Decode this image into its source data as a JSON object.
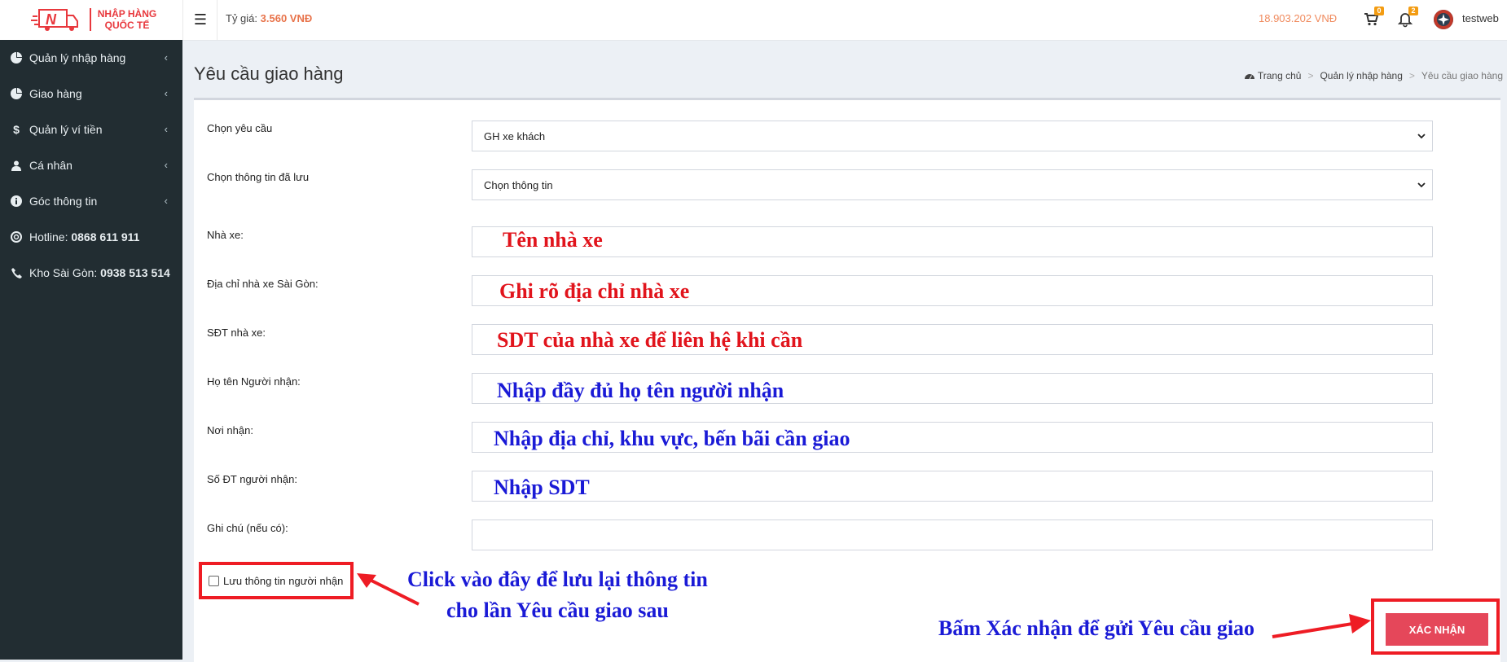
{
  "header": {
    "logo_text_line1": "NHẬP HÀNG",
    "logo_text_line2": "QUỐC TẾ",
    "logo_letter": "N",
    "rate_label": "Tỷ giá:",
    "rate_value": "3.560 VNĐ",
    "balance": "18.903.202 VNĐ",
    "cart_count": "0",
    "notification_count": "2",
    "username": "testweb"
  },
  "sidebar": {
    "items": [
      {
        "label": "Quản lý nhập hàng",
        "icon": "pie-chart-icon"
      },
      {
        "label": "Giao hàng",
        "icon": "pie-chart-icon"
      },
      {
        "label": "Quản lý ví tiền",
        "icon": "dollar-icon"
      },
      {
        "label": "Cá nhân",
        "icon": "user-icon"
      },
      {
        "label": "Góc thông tin",
        "icon": "info-icon"
      }
    ],
    "hotline_label": "Hotline:",
    "hotline_value": "0868 611 911",
    "warehouse_label": "Kho Sài Gòn:",
    "warehouse_value": "0938 513 514"
  },
  "page": {
    "title": "Yêu cầu giao hàng",
    "breadcrumb": [
      "Trang chủ",
      "Quản lý nhập hàng",
      "Yêu cầu giao hàng"
    ]
  },
  "form": {
    "request_label": "Chọn yêu cầu",
    "request_value": "GH xe khách",
    "saved_label": "Chọn thông tin đã lưu",
    "saved_value": "Chọn thông tin",
    "carrier_label": "Nhà xe:",
    "carrier_address_label": "Địa chỉ nhà xe Sài Gòn:",
    "carrier_phone_label": "SĐT nhà xe:",
    "receiver_name_label": "Họ tên Người nhận:",
    "receiver_place_label": "Nơi nhận:",
    "receiver_phone_label": "Số ĐT người nhận:",
    "note_label": "Ghi chú (nếu có):",
    "save_info_label": "Lưu thông tin người nhận",
    "submit_label": "XÁC NHẬN"
  },
  "annotations": {
    "carrier": "Tên nhà xe",
    "carrier_address": "Ghi rõ địa chỉ nhà xe",
    "carrier_phone": "SDT của nhà xe để liên hệ khi cần",
    "receiver_name": "Nhập đầy đủ họ tên người nhận",
    "receiver_place": "Nhập địa chỉ, khu vực, bến bãi cần giao",
    "receiver_phone": "Nhập SDT",
    "save_line1": "Click vào đây để lưu lại thông tin",
    "save_line2": "cho lần Yêu cầu giao sau",
    "submit": "Bấm Xác nhận để gửi Yêu cầu giao"
  },
  "colors": {
    "sidebar_bg": "#222d32",
    "accent_red": "#e1141c",
    "annotation_blue": "#1a1ad6",
    "submit_bg": "#e5475a",
    "balance": "#f08a5d"
  }
}
